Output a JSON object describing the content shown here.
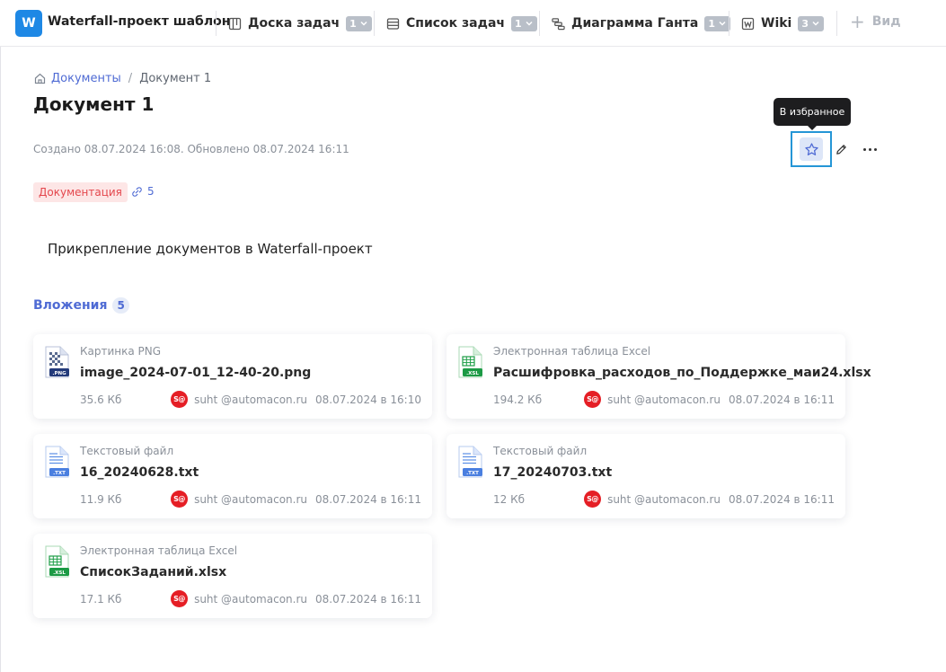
{
  "app": {
    "logo_letter": "W",
    "project_name": "Waterfall-проект шаблон"
  },
  "nav": {
    "tabs": [
      {
        "label": "Доска задач",
        "count": "1",
        "icon": "board-icon"
      },
      {
        "label": "Список задач",
        "count": "1",
        "icon": "list-icon"
      },
      {
        "label": "Диаграмма Ганта",
        "count": "1",
        "icon": "gantt-icon"
      },
      {
        "label": "Wiki",
        "count": "3",
        "icon": "wiki-icon"
      }
    ],
    "add_view_label": "Вид"
  },
  "breadcrumb": {
    "root": "Документы",
    "separator": "/",
    "current": "Документ 1"
  },
  "document": {
    "title": "Документ 1",
    "meta": "Создано 08.07.2024 16:08. Обновлено 08.07.2024 16:11",
    "tag": "Документация",
    "links_count": "5",
    "description": "Прикрепление документов в Waterfall-проект"
  },
  "actions": {
    "favorite_tooltip": "В избранное"
  },
  "attachments": {
    "heading": "Вложения",
    "count": "5",
    "items": [
      {
        "type": "Картинка PNG",
        "name": "image_2024-07-01_12-40-20.png",
        "size": "35.6 Кб",
        "avatar": "S@",
        "owner": "suht @automacon.ru",
        "date": "08.07.2024 в 16:10",
        "badge": ".PNG"
      },
      {
        "type": "Электронная таблица Excel",
        "name": "Расшифровка_расходов_по_Поддержке_маи24.xlsx",
        "size": "194.2 Кб",
        "avatar": "S@",
        "owner": "suht @automacon.ru",
        "date": "08.07.2024 в 16:11",
        "badge": ".XSL"
      },
      {
        "type": "Текстовый файл",
        "name": "16_20240628.txt",
        "size": "11.9 Кб",
        "avatar": "S@",
        "owner": "suht @automacon.ru",
        "date": "08.07.2024 в 16:11",
        "badge": ".TXT"
      },
      {
        "type": "Текстовый файл",
        "name": "17_20240703.txt",
        "size": "12 Кб",
        "avatar": "S@",
        "owner": "suht @automacon.ru",
        "date": "08.07.2024 в 16:11",
        "badge": ".TXT"
      },
      {
        "type": "Электронная таблица Excel",
        "name": "СписокЗаданий.xlsx",
        "size": "17.1 Кб",
        "avatar": "S@",
        "owner": "suht @automacon.ru",
        "date": "08.07.2024 в 16:11",
        "badge": ".XSL"
      }
    ]
  },
  "colors": {
    "accent": "#4f6bd4",
    "brand": "#1e88e5",
    "highlight_border": "#2596d6",
    "tag_text": "#e4474d",
    "tag_bg": "#fde6e6",
    "avatar": "#e51e25"
  }
}
